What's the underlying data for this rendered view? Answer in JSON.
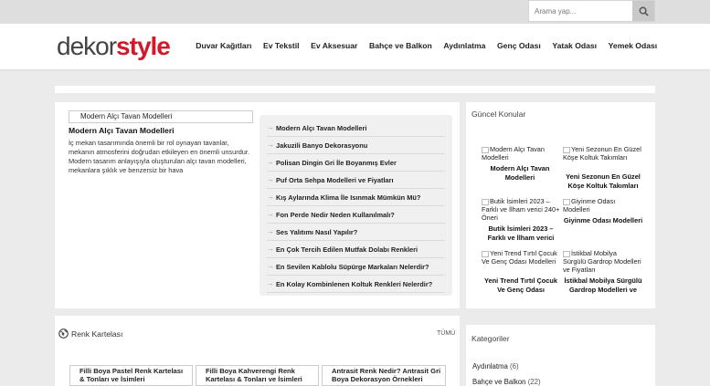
{
  "search": {
    "placeholder": "Arama yap..."
  },
  "logo": {
    "part1": "dekor",
    "part2": "style"
  },
  "nav": [
    "Duvar Kağıtları",
    "Ev Tekstil",
    "Ev Aksesuar",
    "Bahçe ve Balkon",
    "Aydınlatma",
    "Genç Odası",
    "Yatak Odası",
    "Yemek Odası"
  ],
  "featured": {
    "image_alt": "Modern Alçı Tavan Modelleri",
    "title": "Modern Alçı Tavan Modelleri",
    "excerpt": "İç mekan tasarımında önemli bir rol oynayan tavanlar, mekanın atmosferini doğrudan etkileyen en önemli unsurdur. Modern tasarım anlayışıyla oluşturulan alçı tavan modelleri, mekanlara şıklık ve benzersiz bir hava"
  },
  "post_list": [
    "Modern Alçı Tavan Modelleri",
    "Jakuzili Banyo Dekorasyonu",
    "Polisan Dingin Gri İle Boyanmış Evler",
    "Puf Orta Sehpa Modelleri ve Fiyatları",
    "Kış Aylarında Klima İle Isınmak Mümkün Mü?",
    "Fon Perde Nedir Neden Kullanılmalı?",
    "Ses Yalıtımı Nasıl Yapılır?",
    "En Çok Tercih Edilen Mutfak Dolabı Renkleri",
    "En Sevilen Kablolu Süpürge Markaları Nelerdir?",
    "En Kolay Kombinlenen Koltuk Renkleri Nelerdir?"
  ],
  "sidebar": {
    "guncel_title": "Güncel Konular",
    "guncel": [
      {
        "alt": "Modern Alçı Tavan Modelleri",
        "caption": "Modern Alçı Tavan Modelleri"
      },
      {
        "alt": "Yeni Sezonun En Güzel Köşe Koltuk Takımları",
        "caption": "Yeni Sezonun En Güzel Köşe Koltuk Takımları"
      },
      {
        "alt": "Butik İsimleri 2023 – Farklı ve İlham verici 240+ Öneri",
        "caption": "Butik İsimleri 2023 – Farklı ve İlham verici"
      },
      {
        "alt": "Giyinme Odası Modelleri",
        "caption": "Giyinme Odası Modelleri"
      },
      {
        "alt": "Yeni Trend Tırtıl Çocuk Ve Genç Odası Modelleri",
        "caption": "Yeni Trend Tırtıl Çocuk Ve Genç Odası"
      },
      {
        "alt": "İstikbal Mobilya Sürgülü Gardrop Modelleri ve Fiyatları",
        "caption": "İstikbal Mobilya Sürgülü Gardrop Modelleri ve"
      }
    ],
    "kategoriler_title": "Kategoriler",
    "kategoriler": [
      {
        "name": "Aydınlatma",
        "count": "(6)"
      },
      {
        "name": "Bahçe ve Balkon",
        "count": "(22)"
      }
    ]
  },
  "renk": {
    "title": "Renk Kartelası",
    "all_label": "TÜMÜ",
    "items": [
      "Filli Boya Pastel Renk Kartelası & Tonları ve İsimleri",
      "Filli Boya Kahverengi Renk Kartelası & Tonları ve İsimleri",
      "Antrasit Renk Nedir? Antrasit Gri Boya Dekorasyon Örnekleri"
    ]
  }
}
